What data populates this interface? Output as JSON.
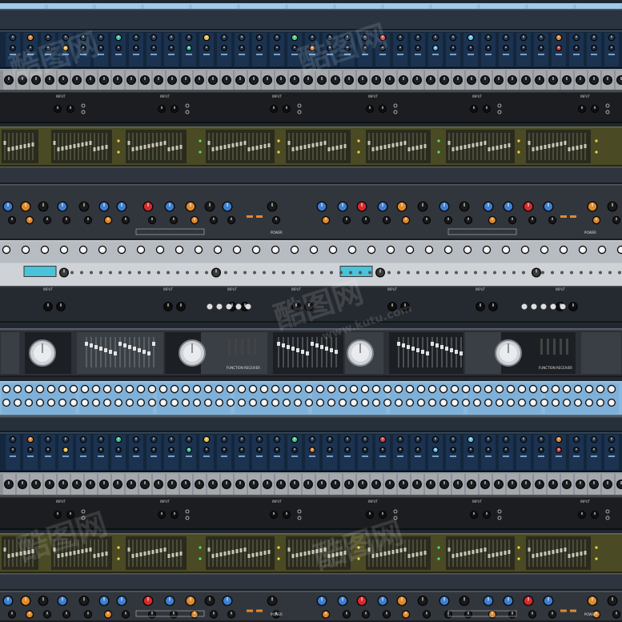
{
  "scene": {
    "description_label": "",
    "watermark_text": "酷图网",
    "watermark_url": "www.kutu.com",
    "unit_labels": {
      "input": "INPUT",
      "power": "POWER",
      "reverb": "FUNCTION  RECEIVER"
    },
    "colors": {
      "background": "#1f2730",
      "top_strip": "#8cbfe4",
      "navy_panel": "#13263b",
      "silver_panel": "#8d9298",
      "black_panel": "#1b1d20",
      "olive_panel": "#4a4a24",
      "dark_grey_panel": "#31363d",
      "light_silver_panel": "#b7bcc2",
      "sky_panel": "#8bb8dc",
      "accent_blue_knob": "#3d7fd0",
      "accent_orange_knob": "#e08a2a",
      "accent_red_knob": "#d92a2a",
      "led_green": "#58e06a",
      "led_yellow": "#f4d34b",
      "lcd": "#49c3d9"
    }
  }
}
